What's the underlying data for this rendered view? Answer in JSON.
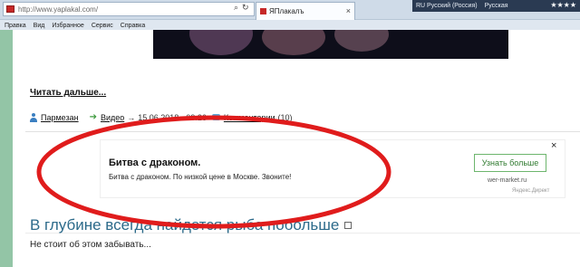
{
  "browser": {
    "url": "http://www.yaplakal.com/",
    "tab_title": "ЯПлакалъ",
    "tab_close": "×",
    "search_icon": "⌕",
    "refresh_icon": "↻",
    "lang1": "RU Русский (Россия)",
    "lang2": "Русская",
    "tray_user": "★★★★",
    "menu": [
      "Правка",
      "Вид",
      "Избранное",
      "Сервис",
      "Справка"
    ]
  },
  "post": {
    "read_more": "Читать дальше...",
    "author": "Пармезан",
    "category": "Видео",
    "date": "15.06.2018 - 09:26",
    "comments_label": "Комментарии",
    "comments_count": "(10)"
  },
  "ad": {
    "title": "Битва с драконом.",
    "text": "Битва с драконом. По низкой цене в Москве. Звоните!",
    "button": "Узнать больше",
    "domain": "wer-market.ru",
    "source": "Яндекс.Директ",
    "close": "×"
  },
  "next_post": {
    "headline": "В глубине всегда найдется рыба побольше",
    "subtitle": "Не стоит об этом забывать..."
  },
  "colors": {
    "accent_green": "#93c5a6",
    "headline_blue": "#2c6a8a",
    "annotation_red": "#e01c1c"
  }
}
